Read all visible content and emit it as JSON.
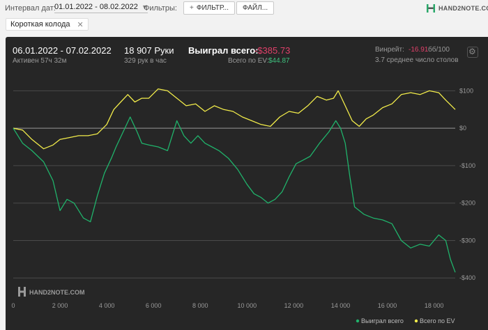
{
  "toolbar": {
    "date_label": "Интервал дат:",
    "date_value": "01.01.2022 - 08.02.2022",
    "filters_label": "Фильтры:",
    "filter_button": "ФИЛЬТР...",
    "files_button": "ФАЙЛ...",
    "logo_text": "HAND2NOTE.COM"
  },
  "chip": {
    "label": "Короткая колода"
  },
  "summary": {
    "period": "06.01.2022 - 07.02.2022",
    "active": "Активен 57ч 32м",
    "hands": "18 907 Руки",
    "hands_per_hour": "329 рук в час",
    "won_label": "Выиграл всего:",
    "won_value": "-$385.73",
    "ev_label": "Всего по EV:",
    "ev_value": "$44.87",
    "winrate_label": "Винрейт:",
    "winrate_value": "-16.91",
    "winrate_unit": "бб/100",
    "tables": "3.7 среднее число столов"
  },
  "chart_data": {
    "type": "line",
    "watermark": "HAND2NOTE.COM",
    "x_ticks": [
      0,
      2000,
      4000,
      6000,
      8000,
      10000,
      12000,
      14000,
      16000,
      18000
    ],
    "x_tick_labels": [
      "0",
      "2 000",
      "4 000",
      "6 000",
      "8 000",
      "10 000",
      "12 000",
      "14 000",
      "16 000",
      "18 000"
    ],
    "y_ticks": [
      100,
      0,
      -100,
      -200,
      -300,
      -400
    ],
    "y_tick_labels": [
      "$100",
      "$0",
      "-$100",
      "-$200",
      "-$300",
      "-$400"
    ],
    "xlim": [
      0,
      18907
    ],
    "ylim": [
      -420,
      110
    ],
    "grid": true,
    "legend_position": "bottom-right",
    "series": [
      {
        "name": "Выиграл всего",
        "color": "#20b36b",
        "x": [
          0,
          400,
          800,
          1300,
          1700,
          2000,
          2300,
          2600,
          3000,
          3300,
          3600,
          3900,
          4200,
          4400,
          4700,
          5000,
          5300,
          5500,
          5800,
          6200,
          6600,
          7000,
          7300,
          7600,
          7900,
          8200,
          8500,
          8800,
          9200,
          9600,
          10000,
          10300,
          10600,
          10900,
          11200,
          11500,
          11800,
          12100,
          12400,
          12700,
          13100,
          13500,
          13800,
          14000,
          14200,
          14400,
          14600,
          15000,
          15400,
          15800,
          16200,
          16600,
          17000,
          17400,
          17800,
          18200,
          18500,
          18700,
          18907
        ],
        "values": [
          0,
          -40,
          -60,
          -90,
          -140,
          -220,
          -190,
          -200,
          -240,
          -250,
          -180,
          -120,
          -80,
          -50,
          -10,
          30,
          -10,
          -40,
          -45,
          -50,
          -60,
          20,
          -20,
          -40,
          -20,
          -40,
          -50,
          -60,
          -80,
          -110,
          -150,
          -175,
          -185,
          -200,
          -190,
          -170,
          -130,
          -95,
          -85,
          -75,
          -40,
          -10,
          20,
          0,
          -40,
          -130,
          -210,
          -230,
          -240,
          -245,
          -255,
          -300,
          -320,
          -310,
          -315,
          -285,
          -300,
          -350,
          -385
        ]
      },
      {
        "name": "Всего по EV",
        "color": "#f2ec4a",
        "x": [
          0,
          400,
          800,
          1300,
          1700,
          2000,
          2400,
          2800,
          3200,
          3600,
          4000,
          4300,
          4600,
          4900,
          5200,
          5500,
          5800,
          6200,
          6600,
          7000,
          7400,
          7800,
          8200,
          8600,
          9000,
          9400,
          9800,
          10200,
          10600,
          11000,
          11400,
          11800,
          12200,
          12600,
          13000,
          13400,
          13700,
          13900,
          14200,
          14500,
          14800,
          15100,
          15400,
          15800,
          16200,
          16600,
          17000,
          17400,
          17800,
          18200,
          18500,
          18907
        ],
        "values": [
          0,
          -5,
          -30,
          -55,
          -45,
          -30,
          -25,
          -20,
          -20,
          -15,
          10,
          50,
          70,
          90,
          70,
          80,
          80,
          105,
          100,
          80,
          60,
          65,
          45,
          60,
          50,
          45,
          30,
          20,
          10,
          5,
          30,
          45,
          40,
          60,
          85,
          75,
          80,
          100,
          60,
          20,
          5,
          25,
          35,
          55,
          65,
          90,
          95,
          90,
          100,
          95,
          75,
          50
        ]
      }
    ]
  }
}
